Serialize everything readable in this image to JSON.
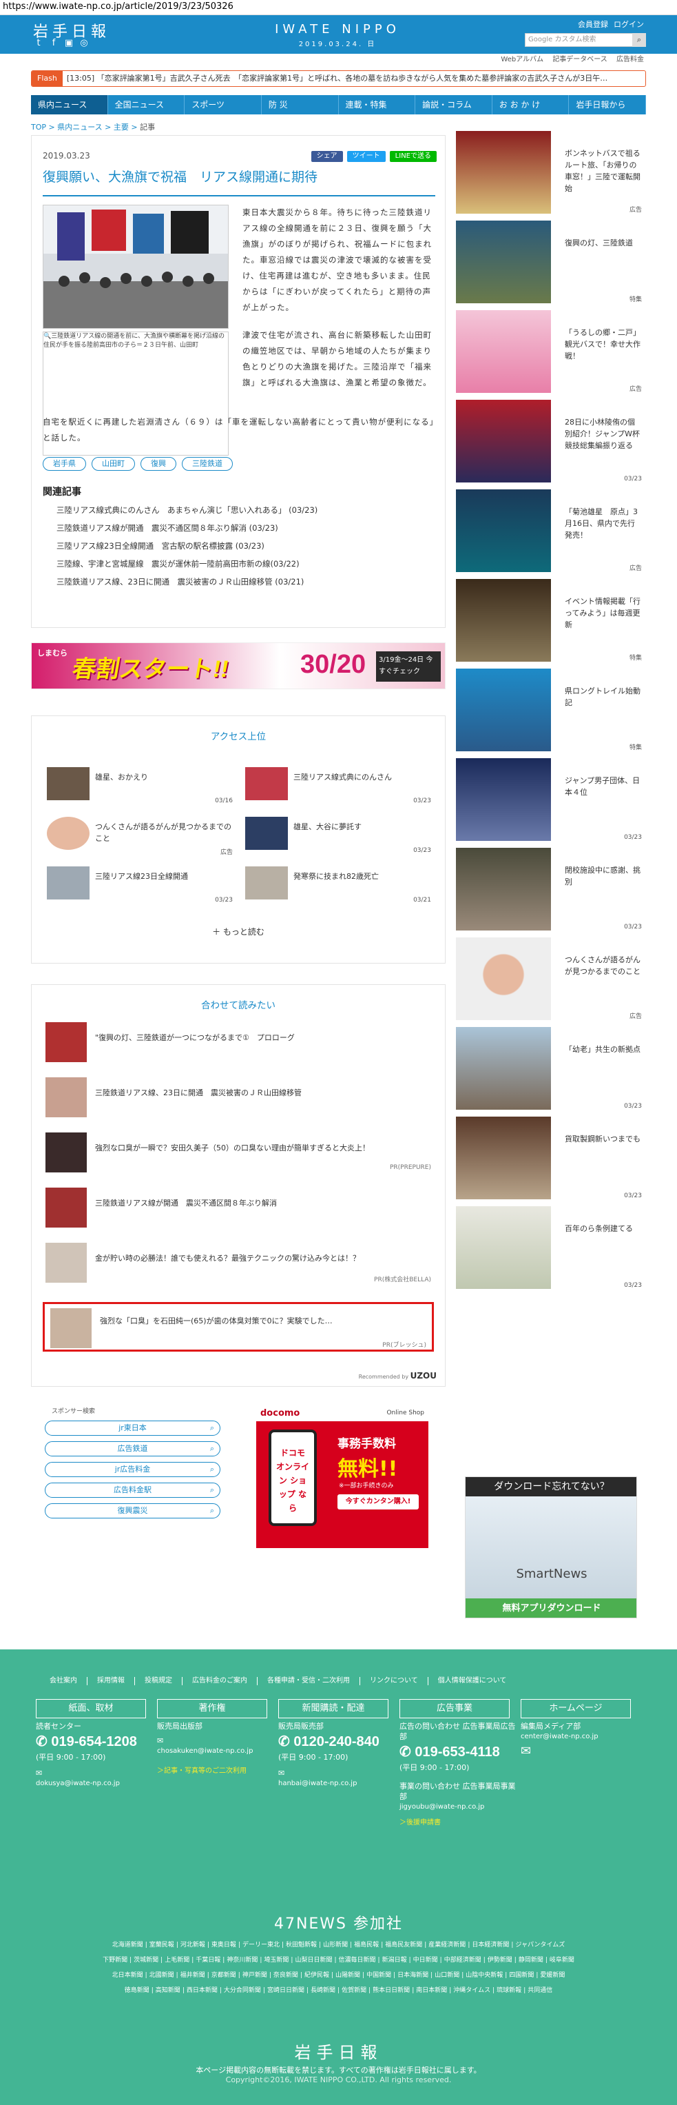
{
  "url": "https://www.iwate-np.co.jp/article/2019/3/23/50326",
  "header": {
    "logo": "岩手日報",
    "brand_name": "IWATE NIPPO",
    "brand_date": "2019.03.24. 日",
    "links": [
      "会員登録",
      "ログイン"
    ],
    "search_placeholder": "Google カスタム検索",
    "sub_links": [
      "Webアルバム",
      "記事データベース",
      "広告料金"
    ],
    "social_icons": [
      "twitter-icon",
      "facebook-icon",
      "line-icon",
      "instagram-icon"
    ]
  },
  "flash": {
    "label": "Flash",
    "text": "[13:05] 「恋家評論家第1号」吉武久子さん死去　「恋家評論家第1号」と呼ばれ、各地の墓を訪ね歩きながら人気を集めた墓参評論家の吉武久子さんが3日午…"
  },
  "gnav": [
    "県内ニュース",
    "全国ニュース",
    "スポーツ",
    "防 災",
    "連載・特集",
    "論説・コラム",
    "お お か け",
    "岩手日報から"
  ],
  "breadcrumb": [
    "TOP",
    "県内ニュース",
    "主要",
    "記事"
  ],
  "article": {
    "date": "2019.03.23",
    "share": [
      "シェア",
      "ツイート",
      "LINEで送る"
    ],
    "title": "復興願い、大漁旗で祝福　リアス線開通に期待",
    "photo_caption": "三陸鉄道リアス線の開通を前に、大漁旗や横断幕を掲げ沿線の住民が手を振る陸前高田市の子ら＝２３日午前、山田町",
    "body_p1": "東日本大震災から８年。待ちに待った三陸鉄道リアス線の全線開通を前に２３日、復興を願う「大漁旗」がのぼりが掲げられ、祝福ムードに包まれた。車窓沿線では震災の津波で壊滅的な被害を受け、住宅再建は進むが、空き地も多いまま。住民からは「にぎわいが戻ってくれたら」と期待の声が上がった。",
    "body_p2": "津波で住宅が流され、高台に新築移転した山田町の織笠地区では、早朝から地域の人たちが集まり色とりどりの大漁旗を掲げた。三陸沿岸で「福来旗」と呼ばれる大漁旗は、漁業と希望の象徴だ。",
    "body_p3": "自宅を駅近くに再建した岩淵清さん（６９）は「車を運転しない高齢者にとって貴い物が便利になる」と話した。",
    "tags": [
      "岩手県",
      "山田町",
      "復興",
      "三陸鉄道"
    ],
    "related_heading": "関連記事",
    "related": [
      "三陸リアス線式典にのんさん　あまちゃん演じ「思い入れある」 (03/23)",
      "三陸鉄道リアス線が開通　震災不通区間８年ぶり解消 (03/23)",
      "三陸リアス線23日全線開通　宮古駅の駅名標披露 (03/23)",
      "三陸線、宇津と宮城屋線　震災が運休前一陸前高田市新の線(03/22)",
      "三陸鉄道リアス線、23日に開通　震災被害のＪＲ山田線移管 (03/21)"
    ]
  },
  "banner_ad": {
    "brand": "しまむら",
    "text": "春割スタート!!",
    "discount": "30/20",
    "dates": "3/19金〜24日 今すぐチェック"
  },
  "ranking": {
    "heading": "アクセス上位",
    "items": [
      {
        "text": "雄星、おかえり",
        "date": "03/16"
      },
      {
        "text": "三陸リアス線式典にのんさん",
        "date": "03/23"
      },
      {
        "text": "つんくさんが語るがんが見つかるまでのこと",
        "date": "広告"
      },
      {
        "text": "雄星、大谷に夢託す",
        "date": "03/23"
      },
      {
        "text": "三陸リアス線23日全線開通",
        "date": "03/23"
      },
      {
        "text": "発寒祭に技まれ82歳死亡",
        "date": "03/21"
      }
    ],
    "more": "もっと読む"
  },
  "recommend": {
    "heading": "合わせて読みたい",
    "items": [
      {
        "text": "\"復興の灯、三陸鉄道が一つにつながるまで①　プロローグ",
        "pr": ""
      },
      {
        "text": "三陸鉄道リアス線、23日に開通　震災被害のＪＲ山田線移管",
        "pr": ""
      },
      {
        "text": "強烈な口臭が一瞬で？安田久美子（50）の口臭ない理由が簡単すぎると大炎上！",
        "pr": "PR(PREPURE)"
      },
      {
        "text": "三陸鉄道リアス線が開通　震災不通区間８年ぶり解消",
        "pr": ""
      },
      {
        "text": "金が貯い時の必勝法！誰でも使えれる？最強テクニックの驚け込み今とは！？",
        "pr": "PR(株式会社BELLA)"
      },
      {
        "text": "強烈な「口臭」を石田純一(65)が歯の体臭対策で0に？実験でした…",
        "pr": "PR(ブレッシュ)"
      }
    ],
    "credit": "Recommended by",
    "credit_brand": "UZOU"
  },
  "sponsor": {
    "heading": "スポンサー検索",
    "items": [
      "jr東日本",
      "広告鉄道",
      "jr広告料金",
      "広告料金駅",
      "復興震災"
    ]
  },
  "docomo_ad": {
    "brand": "docomo",
    "shop": "Online Shop",
    "title": "事務手数料",
    "free": "無料!!",
    "note": "※一部お手続きのみ",
    "phone_text": "ドコモ オンライン ショップ なら",
    "cta": "今すぐカンタン購入!"
  },
  "sidebar": [
    {
      "text": "ボンネットバスで祖るルート旅、「お帰りの車窓！」三陸で運転開始",
      "meta": "広告"
    },
    {
      "text": "復興の灯、三陸鉄道",
      "meta": "特集"
    },
    {
      "text": "「うるしの郷・二戸」観光バスで！幸せ大作戦！",
      "meta": "広告"
    },
    {
      "text": "28日に小林陵侑の個別紹介！ジャンプW杯競技総集編振り返る",
      "meta": "03/23"
    },
    {
      "text": "「菊池雄星　原点」3月16日、県内で先行発売！",
      "meta": "広告"
    },
    {
      "text": "イベント情報掲載「行ってみよう」は毎週更新",
      "meta": "特集"
    },
    {
      "text": "県ロングトレイル始動記",
      "meta": "特集"
    },
    {
      "text": "ジャンプ男子団体、日本４位",
      "meta": "03/23"
    },
    {
      "text": "閉校施設中に惑謝、挑別",
      "meta": "03/23"
    },
    {
      "text": "つんくさんが語るがんが見つかるまでのこと",
      "meta": "広告"
    },
    {
      "text": "「幼老」共生の新拠点",
      "meta": "03/23"
    },
    {
      "text": "貨取製鋼新いつまでも",
      "meta": "03/23"
    },
    {
      "text": "百年のら条例建てる",
      "meta": "03/23"
    }
  ],
  "smartnews": {
    "top": "ダウンロード忘れてない？",
    "brand": "SmartNews",
    "cta": "無料アプリダウンロード"
  },
  "footer": {
    "links": [
      "会社案内",
      "採用情報",
      "投稿規定",
      "広告料金のご案内",
      "各種申請・受信・二次利用",
      "リンクについて",
      "個人情報保護について"
    ],
    "buttons": [
      "紙面、取材",
      "著作権",
      "新聞購読・配達",
      "広告事業",
      "ホームページ"
    ],
    "reader": {
      "label": "読者センター",
      "tel": "019-654-1208",
      "hours": "(平日 9:00 - 17:00)",
      "mail": "dokusya@iwate-np.co.jp"
    },
    "copyright": {
      "label": "販売局出版部",
      "mail": "chosakuken@iwate-np.co.jp",
      "link": "＞記事・写真等のご二次利用"
    },
    "sales": {
      "label": "販売局販売部",
      "tel": "0120-240-840",
      "hours": "(平日 9:00 - 17:00)",
      "mail": "hanbai@iwate-np.co.jp"
    },
    "ads": {
      "label": "広告の問い合わせ 広告事業局広告部",
      "tel": "019-653-4118",
      "hours": "(平日 9:00 - 17:00)",
      "label2": "事業の問い合わせ 広告事業局事業部",
      "mail": "jigyoubu@iwate-np.co.jp",
      "link": "＞後援申請書"
    },
    "hp": {
      "label": "編集局メディア部",
      "mail": "center@iwate-np.co.jp"
    },
    "news47": "47NEWS 参加社",
    "papers1": [
      "北海道新聞",
      "室蘭民報",
      "河北新報",
      "東奥日報",
      "デーリー東北",
      "秋田魁新報",
      "山形新聞",
      "福島民報",
      "福島民友新聞",
      "産業経済新聞",
      "日本経済新聞",
      "ジャパンタイムズ"
    ],
    "papers2": [
      "下野新聞",
      "茨城新聞",
      "上毛新聞",
      "千葉日報",
      "神奈川新聞",
      "埼玉新聞",
      "山梨日日新聞",
      "信濃毎日新聞",
      "新潟日報",
      "中日新聞",
      "中部経済新聞",
      "伊勢新聞",
      "静岡新聞",
      "岐阜新聞"
    ],
    "papers3": [
      "北日本新聞",
      "北國新聞",
      "福井新聞",
      "京都新聞",
      "神戸新聞",
      "奈良新聞",
      "紀伊民報",
      "山陽新聞",
      "中国新聞",
      "日本海新聞",
      "山口新聞",
      "山陰中央新報",
      "四国新聞",
      "愛媛新聞"
    ],
    "papers4": [
      "徳島新聞",
      "高知新聞",
      "西日本新聞",
      "大分合同新聞",
      "宮崎日日新聞",
      "長崎新聞",
      "佐賀新聞",
      "熊本日日新聞",
      "南日本新聞",
      "沖縄タイムス",
      "琉球新報",
      "共同通信"
    ],
    "logo": "岩手日報",
    "notice": "本ページ掲載内容の無断転載を禁じます。すべての著作権は岩手日報社に属します。",
    "copy": "Copyright©2016, IWATE NIPPO CO.,LTD. All rights reserved."
  }
}
